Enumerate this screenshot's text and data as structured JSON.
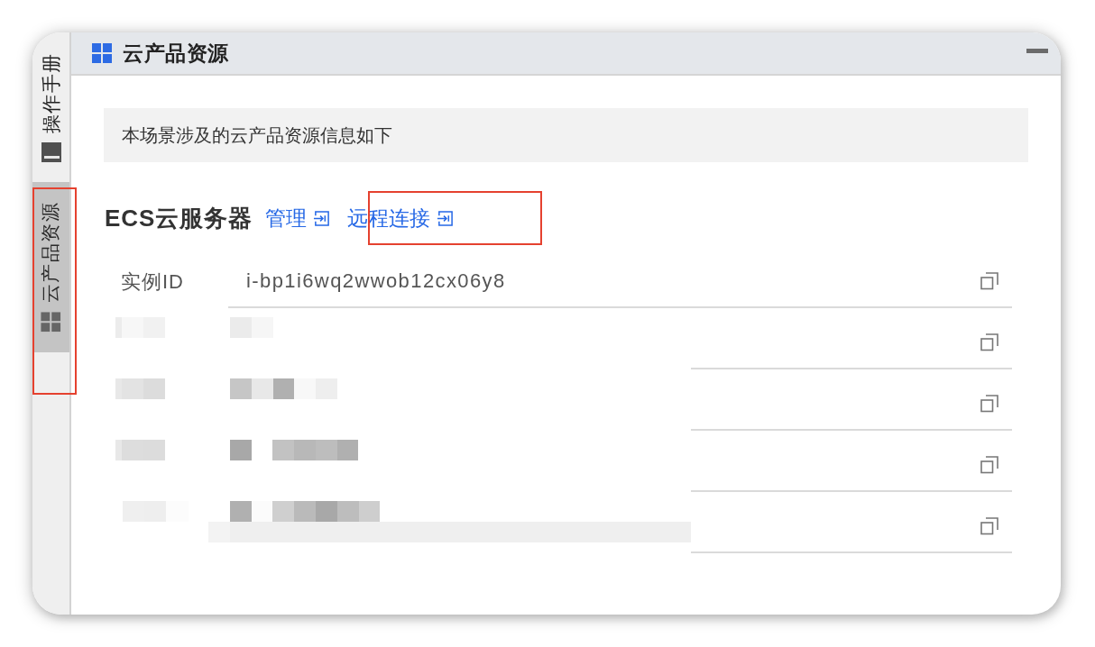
{
  "sidebar": {
    "tabs": [
      {
        "label": "操作手册",
        "selected": false,
        "highlighted": false
      },
      {
        "label": "云产品资源",
        "selected": true,
        "highlighted": true
      }
    ]
  },
  "panel": {
    "title": "云产品资源"
  },
  "notice": "本场景涉及的云产品资源信息如下",
  "section": {
    "title": "ECS云服务器",
    "links": [
      {
        "label": "管理",
        "highlighted": false
      },
      {
        "label": "远程连接",
        "highlighted": true
      }
    ],
    "rows": [
      {
        "kind": "field",
        "label": "实例ID",
        "value": "i-bp1i6wq2wwob12cx06y8"
      },
      {
        "kind": "redacted"
      },
      {
        "kind": "redacted"
      },
      {
        "kind": "redacted"
      },
      {
        "kind": "redacted"
      }
    ]
  }
}
